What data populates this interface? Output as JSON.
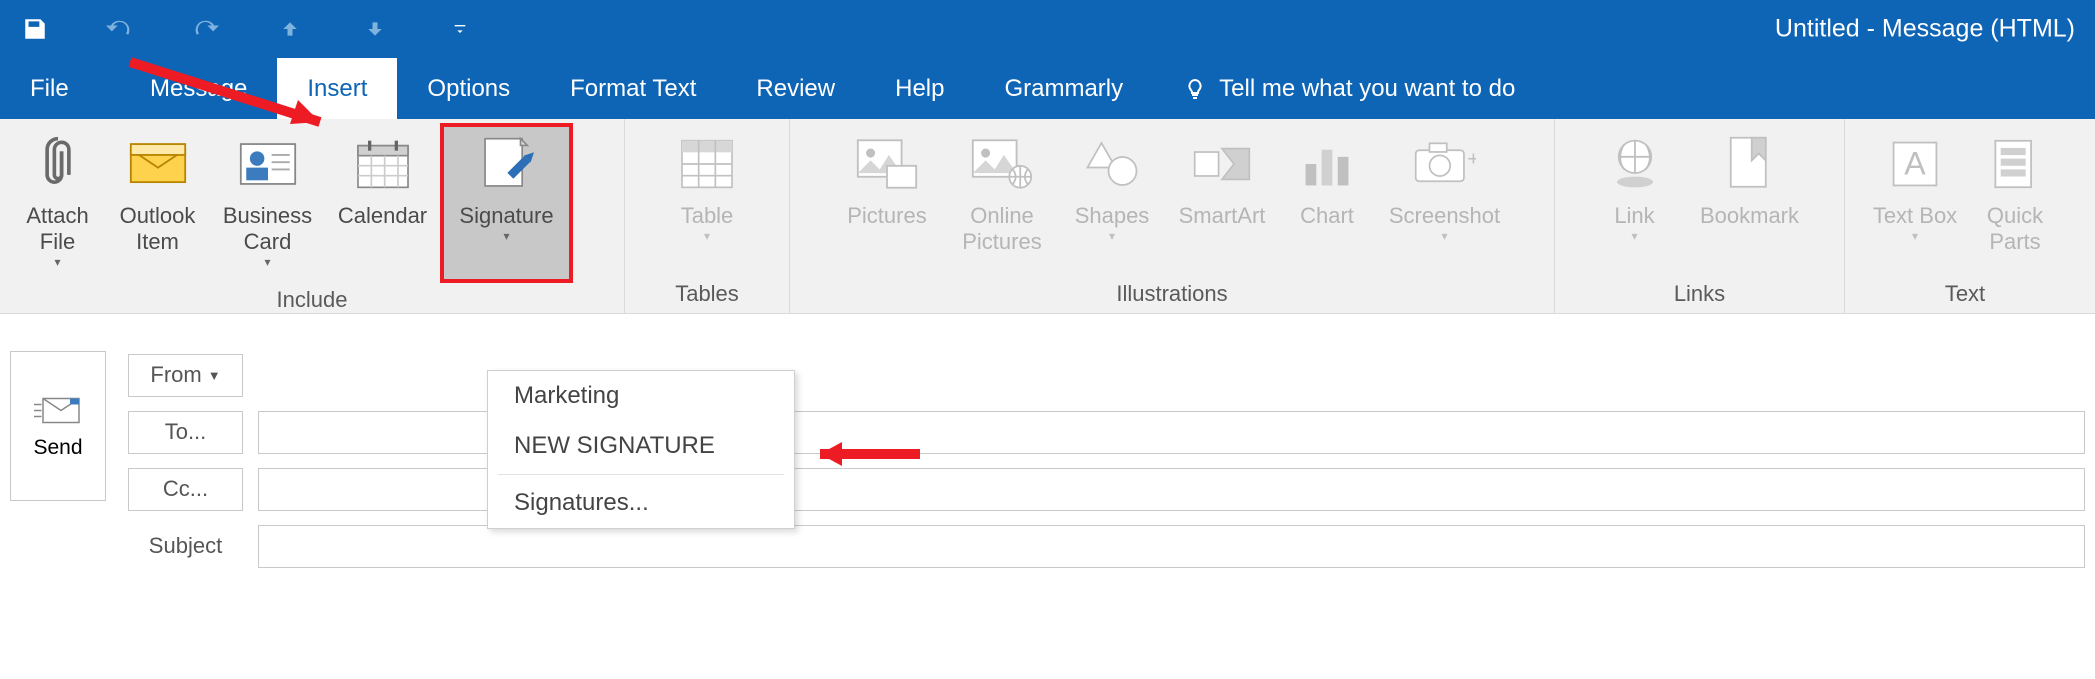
{
  "window_title": "Untitled  -  Message (HTML)",
  "tabs": {
    "file": "File",
    "message": "Message",
    "insert": "Insert",
    "options": "Options",
    "format": "Format Text",
    "review": "Review",
    "help": "Help",
    "grammarly": "Grammarly"
  },
  "tellme": "Tell me what you want to do",
  "ribbon": {
    "include": {
      "label": "Include",
      "attach": "Attach File",
      "outlook_item": "Outlook Item",
      "biz_card": "Business Card",
      "calendar": "Calendar",
      "signature": "Signature"
    },
    "tables": {
      "label": "Tables",
      "table": "Table"
    },
    "illustrations": {
      "label": "Illustrations",
      "pictures": "Pictures",
      "online_pics": "Online Pictures",
      "shapes": "Shapes",
      "smartart": "SmartArt",
      "chart": "Chart",
      "screenshot": "Screenshot"
    },
    "links": {
      "label": "Links",
      "link": "Link",
      "bookmark": "Bookmark"
    },
    "text": {
      "label": "Text",
      "textbox": "Text Box",
      "quick": "Quick Parts"
    }
  },
  "signature_menu": {
    "item1": "Marketing",
    "item2": "NEW SIGNATURE",
    "item3": "Signatures..."
  },
  "compose": {
    "send": "Send",
    "from": "From",
    "to": "To...",
    "cc": "Cc...",
    "subject": "Subject"
  }
}
